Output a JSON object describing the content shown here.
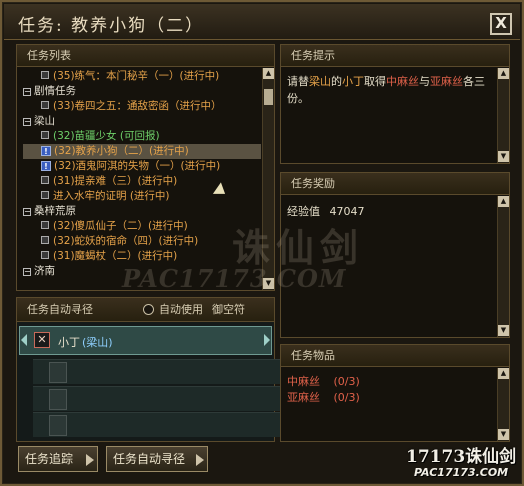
{
  "window": {
    "title": "任务: 教养小狗（二）",
    "close_label": "X"
  },
  "task_list": {
    "header": "任务列表",
    "rows": [
      {
        "kind": "quest",
        "icon": "bullet",
        "text": "(35)练气：本门秘辛（一）(进行中)",
        "color": "org"
      },
      {
        "kind": "category",
        "text": "剧情任务"
      },
      {
        "kind": "quest",
        "icon": "bullet",
        "text": "(33)卷四之五：通敌密函（进行中）",
        "color": "org"
      },
      {
        "kind": "category",
        "text": "梁山"
      },
      {
        "kind": "quest",
        "icon": "bullet",
        "text": "(32)苗疆少女 (可回报)",
        "color": "grn"
      },
      {
        "kind": "quest",
        "icon": "bang",
        "text": "(32)教养小狗（二）(进行中)",
        "color": "org",
        "selected": true
      },
      {
        "kind": "quest",
        "icon": "bang",
        "text": "(32)酒鬼阿淇的失物（一）(进行中)",
        "color": "org"
      },
      {
        "kind": "quest",
        "icon": "bullet",
        "text": "(31)提亲难（三）(进行中)",
        "color": "org"
      },
      {
        "kind": "quest",
        "icon": "bullet",
        "text": "进入水牢的证明 (进行中)",
        "color": "org"
      },
      {
        "kind": "category",
        "text": "桑梓荒原"
      },
      {
        "kind": "quest",
        "icon": "bullet",
        "text": "(32)傻瓜仙子（二）(进行中)",
        "color": "org"
      },
      {
        "kind": "quest",
        "icon": "bullet",
        "text": "(32)蛇妖的宿命（四）(进行中)",
        "color": "org"
      },
      {
        "kind": "quest",
        "icon": "bullet",
        "text": "(31)魔蝎杖（二）(进行中)",
        "color": "org"
      },
      {
        "kind": "category",
        "text": "济南"
      }
    ]
  },
  "auto_path": {
    "header": "任务自动寻径",
    "checkbox_label": "自动使用",
    "checkbox_checked": false,
    "extra_label": "御空符",
    "entries": [
      {
        "name": "小丁",
        "place": "(梁山)"
      }
    ]
  },
  "buttons": {
    "track": "任务追踪",
    "auto_path": "任务自动寻径"
  },
  "hint": {
    "header": "任务提示",
    "parts": [
      {
        "text": "请替",
        "color": "wht"
      },
      {
        "text": "梁山",
        "color": "org"
      },
      {
        "text": "的",
        "color": "wht"
      },
      {
        "text": "小丁",
        "color": "org"
      },
      {
        "text": "取得",
        "color": "wht"
      },
      {
        "text": "中麻丝",
        "color": "red"
      },
      {
        "text": "与",
        "color": "wht"
      },
      {
        "text": "亚麻丝",
        "color": "red"
      },
      {
        "text": "各三份。",
        "color": "wht"
      }
    ]
  },
  "reward": {
    "header": "任务奖励",
    "exp_label": "经验值",
    "exp_value": "47047"
  },
  "items": {
    "header": "任务物品",
    "list": [
      {
        "name": "中麻丝",
        "count": "(0/3)"
      },
      {
        "name": "亚麻丝",
        "count": "(0/3)"
      }
    ]
  },
  "watermark": {
    "brand_mid": "诛仙剑",
    "site_mid": "PAC17173.COM",
    "brand_corner": "17173诛仙剑",
    "site_corner": "PAC17173.COM"
  },
  "colors": {
    "orange": "#e6a34a",
    "green": "#6fd16a",
    "red": "#e0614a",
    "frame": "#6e5a36"
  }
}
